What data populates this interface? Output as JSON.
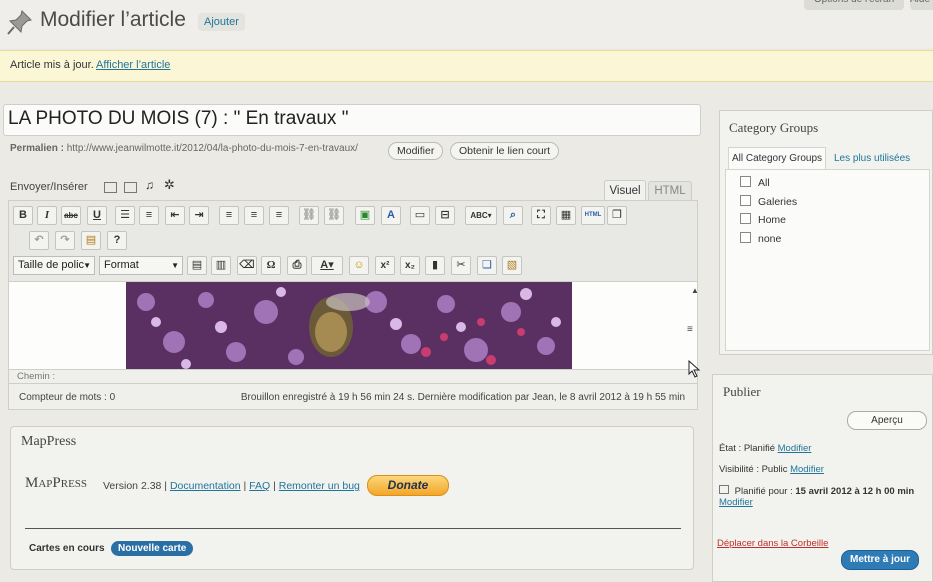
{
  "header": {
    "title": "Modifier l’article",
    "add_label": "Ajouter",
    "screen_options_label": "Options de l'écran",
    "help_label": "Aide"
  },
  "notice": {
    "text": "Article mis à jour.",
    "link": "Afficher l’article"
  },
  "post": {
    "title": "LA PHOTO DU MOIS  (7) : \" En travaux \"",
    "permalink_label": "Permalien :",
    "permalink_url": "http://www.jeanwilmotte.it/2012/04/la-photo-du-mois-7-en-travaux/",
    "edit_permalink_label": "Modifier",
    "shortlink_label": "Obtenir le lien court"
  },
  "editor": {
    "upload_label": "Envoyer/Insérer",
    "tab_visual": "Visuel",
    "tab_html": "HTML",
    "font_size_select": "Taille de polic",
    "format_select": "Format",
    "path_label": "Chemin :",
    "word_count_label": "Compteur de mots : 0",
    "draft_status": "Brouillon enregistré à 19 h 56 min 24 s. Dernière modification par Jean, le 8 avril 2012 à 19 h 55 min",
    "image_subject": "flower-photo"
  },
  "mappress": {
    "title": "MapPress",
    "logo": "MapPress",
    "version": "Version 2.38 |",
    "documentation_link": "Documentation",
    "faq_link": "FAQ",
    "bug_link": "Remonter un bug",
    "separator": "|",
    "donate_label": "Donate",
    "maps_label": "Cartes en cours",
    "new_map_label": "Nouvelle carte"
  },
  "category_groups": {
    "title": "Category Groups",
    "tab_all": "All Category Groups",
    "tab_popular": "Les plus utilisées",
    "items": [
      "All",
      "Galeries",
      "Home",
      "none"
    ]
  },
  "publish": {
    "title": "Publier",
    "preview_label": "Aperçu",
    "state_label": "État : Planifié",
    "state_link": "Modifier",
    "visibility_label": "Visibilité : Public",
    "visibility_link": "Modifier",
    "schedule_label": "Planifié pour :",
    "schedule_value": "15 avril 2012 à 12 h 00 min",
    "schedule_link": "Modifier",
    "trash_label": "Déplacer dans la Corbeille",
    "update_label": "Mettre à jour"
  },
  "colors": {
    "link": "#21759b",
    "notice_bg": "#fbf7d6",
    "primary_button": "#2f7bb6",
    "trash": "#c0302a"
  }
}
